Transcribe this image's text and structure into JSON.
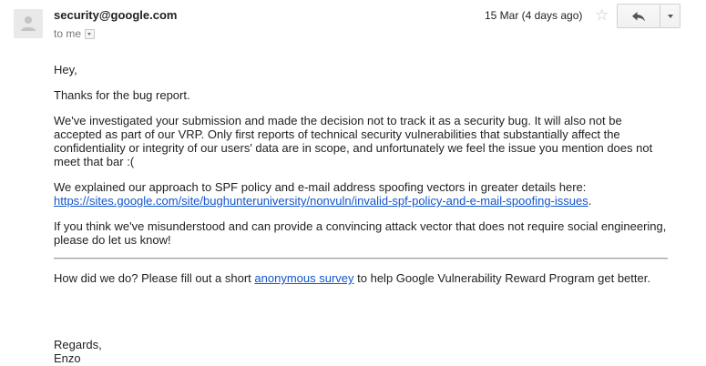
{
  "header": {
    "sender": "security@google.com",
    "recipient_label": "to me",
    "date": "15 Mar (4 days ago)"
  },
  "icons": {
    "avatar": "person-silhouette-icon",
    "star": "star-icon",
    "reply": "reply-arrow-icon",
    "more": "chevron-down-icon",
    "recipient_details": "chevron-down-icon"
  },
  "colors": {
    "link": "#1155cc",
    "muted": "#777777",
    "text": "#222222"
  },
  "body": {
    "greeting": "Hey,",
    "thanks": "Thanks for the bug report.",
    "paragraph1": "We've investigated your submission and made the decision not to track it as a security bug. It will also not be accepted as part of our VRP. Only first reports of technical security vulnerabilities that substantially affect the confidentiality or integrity of our users' data are in scope, and unfortunately we feel the issue you mention does not meet that bar :(",
    "paragraph2_intro": "We explained our approach to SPF policy and e-mail address spoofing vectors in greater details here:",
    "paragraph2_link": "https://sites.google.com/site/bughunteruniversity/nonvuln/invalid-spf-policy-and-e-mail-spoofing-issues",
    "paragraph2_end": ".",
    "paragraph3": "If you think we've misunderstood and can provide a convincing attack vector that does not require social engineering, please do let us know!",
    "survey_before": "How did we do? Please fill out a short ",
    "survey_link": "anonymous survey",
    "survey_after": " to help Google Vulnerability Reward Program get better.",
    "closing": "Regards,",
    "signature": "Enzo"
  }
}
